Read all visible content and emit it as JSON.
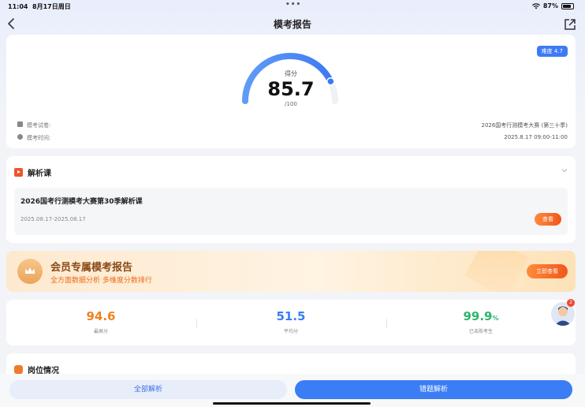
{
  "status_bar": {
    "time": "11:04",
    "date": "8月17日周日",
    "dots": "•••",
    "battery": "87%"
  },
  "nav": {
    "title": "模考报告"
  },
  "score": {
    "difficulty_badge": "难度 4.7",
    "label": "得分",
    "value": "85.7",
    "total": "/100",
    "fraction": 0.857
  },
  "exam_info": {
    "paper_label": "模考试卷:",
    "paper_value": "2026国考行测模考大赛 (第三十季)",
    "time_label": "模考时间:",
    "time_value": "2025.8.17 09:00-11:00"
  },
  "lesson": {
    "section_title": "解析课",
    "title": "2026国考行测模考大赛第30季解析课",
    "date": "2025.08.17-2025.08.17",
    "view_button": "查看"
  },
  "vip": {
    "title": "会员专属模考报告",
    "subtitle": "全方面数据分析 多维度分数排行",
    "button": "立即查看"
  },
  "stats": [
    {
      "value": "94.6",
      "unit": "",
      "caption": "最高分",
      "color": "#f0821e"
    },
    {
      "value": "51.5",
      "unit": "",
      "caption": "平均分",
      "color": "#3a7df5"
    },
    {
      "value": "99.9",
      "unit": "%",
      "caption": "已击败考生",
      "color": "#2db66a"
    }
  ],
  "assistant": {
    "badge": "2"
  },
  "position": {
    "section_title": "岗位情况"
  },
  "bottom": {
    "all_button": "全部解析",
    "wrong_button": "错题解析"
  },
  "colors": {
    "accent": "#3a7df5",
    "orange": "#f2561c"
  }
}
